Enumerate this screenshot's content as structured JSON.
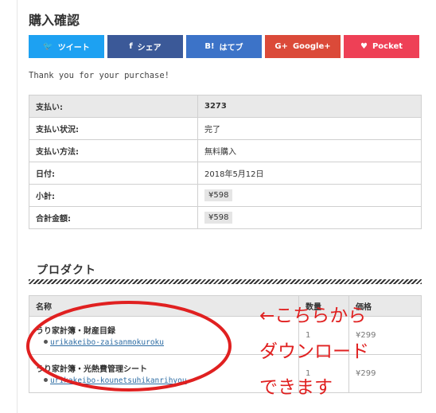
{
  "page_title": "購入確認",
  "share_buttons": [
    {
      "icon": "twitter-bird-icon",
      "glyph": "🐦",
      "label": "ツイート",
      "color": "#1da1f2"
    },
    {
      "icon": "facebook-f-icon",
      "glyph": "f",
      "label": "シェア",
      "color": "#3b5998"
    },
    {
      "icon": "hatena-b-icon",
      "glyph": "B!",
      "label": "はてブ",
      "color": "#3c73c8"
    },
    {
      "icon": "google-plus-icon",
      "glyph": "G+",
      "label": "Google+",
      "color": "#db4a39"
    },
    {
      "icon": "pocket-icon",
      "glyph": "♥",
      "label": "Pocket",
      "color": "#ee4056"
    }
  ],
  "thanks_message": "Thank you for your purchase!",
  "summary": {
    "payment_id_label": "支払い:",
    "payment_id_value": "3273",
    "status_label": "支払い状況:",
    "status_value": "完了",
    "method_label": "支払い方法:",
    "method_value": "無料購入",
    "date_label": "日付:",
    "date_value": "2018年5月12日",
    "subtotal_label": "小計:",
    "subtotal_value": "¥598",
    "total_label": "合計金額:",
    "total_value": "¥598"
  },
  "products_section": {
    "title": "プロダクト",
    "headers": {
      "name": "名称",
      "qty": "数量",
      "price": "価格"
    },
    "items": [
      {
        "name": "うり家計簿・財産目録",
        "file": "urikakeibo-zaisanmokuroku",
        "qty": "1",
        "price": "¥299"
      },
      {
        "name": "うり家計簿・光熱費管理シート",
        "file": "urikakeibo-kounetsuhikanrihyou",
        "qty": "1",
        "price": "¥299"
      }
    ]
  },
  "annotation": {
    "line1": "←こちらから",
    "line2": "ダウンロード",
    "line3": "できます",
    "color": "#e02020"
  }
}
